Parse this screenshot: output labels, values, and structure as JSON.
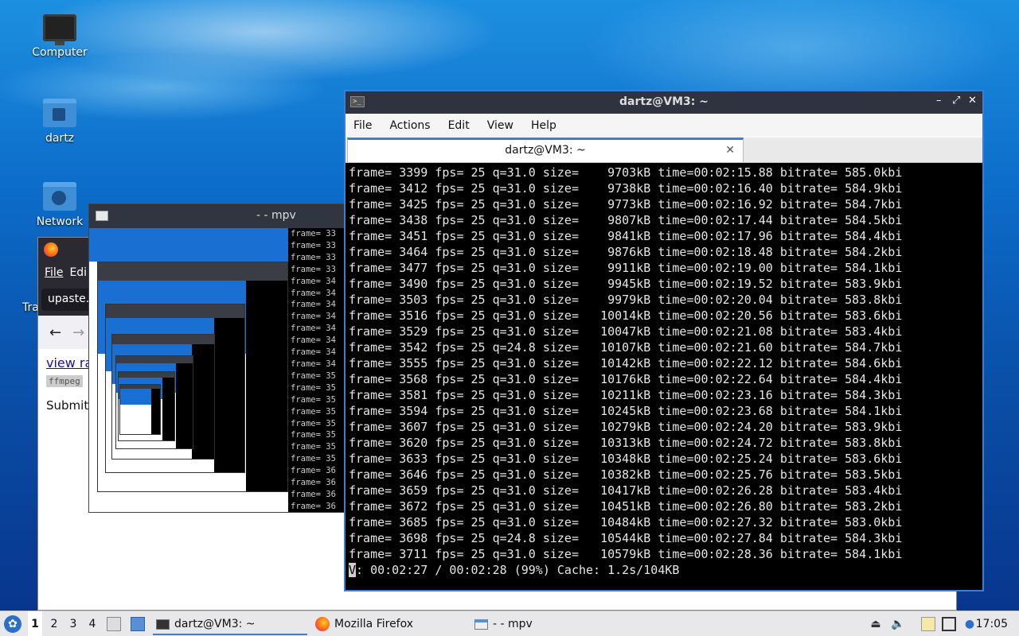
{
  "desktop": {
    "icons": [
      {
        "label": "Computer"
      },
      {
        "label": "dartz"
      },
      {
        "label": "Network"
      },
      {
        "label": "Tra"
      }
    ]
  },
  "firefox": {
    "menu": [
      "File",
      "Edi"
    ],
    "url": "upaste.c",
    "nav": {
      "back": "←",
      "forward": "→"
    },
    "view_raw": "view ra",
    "code_snippet": "ffmpeg",
    "submitted": "Submitte"
  },
  "mpv": {
    "title": "- - mpv",
    "term_lines": [
      "frame= 33",
      "frame= 33",
      "frame= 33",
      "frame= 33",
      "frame= 34",
      "frame= 34",
      "frame= 34",
      "frame= 34",
      "frame= 34",
      "frame= 34",
      "frame= 34",
      "frame= 34",
      "frame= 35",
      "frame= 35",
      "frame= 35",
      "frame= 35",
      "frame= 35",
      "frame= 35",
      "frame= 35",
      "frame= 35",
      "frame= 36",
      "frame= 36",
      "frame= 36",
      "frame= 36"
    ]
  },
  "terminal": {
    "window_title": "dartz@VM3: ~",
    "tab_title": "dartz@VM3: ~",
    "menu": [
      "File",
      "Actions",
      "Edit",
      "View",
      "Help"
    ],
    "controls": {
      "minimize": "–",
      "maximize": "⤢",
      "close": "✕"
    },
    "lines": [
      "frame= 3399 fps= 25 q=31.0 size=    9703kB time=00:02:15.88 bitrate= 585.0kbi",
      "frame= 3412 fps= 25 q=31.0 size=    9738kB time=00:02:16.40 bitrate= 584.9kbi",
      "frame= 3425 fps= 25 q=31.0 size=    9773kB time=00:02:16.92 bitrate= 584.7kbi",
      "frame= 3438 fps= 25 q=31.0 size=    9807kB time=00:02:17.44 bitrate= 584.5kbi",
      "frame= 3451 fps= 25 q=31.0 size=    9841kB time=00:02:17.96 bitrate= 584.4kbi",
      "frame= 3464 fps= 25 q=31.0 size=    9876kB time=00:02:18.48 bitrate= 584.2kbi",
      "frame= 3477 fps= 25 q=31.0 size=    9911kB time=00:02:19.00 bitrate= 584.1kbi",
      "frame= 3490 fps= 25 q=31.0 size=    9945kB time=00:02:19.52 bitrate= 583.9kbi",
      "frame= 3503 fps= 25 q=31.0 size=    9979kB time=00:02:20.04 bitrate= 583.8kbi",
      "frame= 3516 fps= 25 q=31.0 size=   10014kB time=00:02:20.56 bitrate= 583.6kbi",
      "frame= 3529 fps= 25 q=31.0 size=   10047kB time=00:02:21.08 bitrate= 583.4kbi",
      "frame= 3542 fps= 25 q=24.8 size=   10107kB time=00:02:21.60 bitrate= 584.7kbi",
      "frame= 3555 fps= 25 q=31.0 size=   10142kB time=00:02:22.12 bitrate= 584.6kbi",
      "frame= 3568 fps= 25 q=31.0 size=   10176kB time=00:02:22.64 bitrate= 584.4kbi",
      "frame= 3581 fps= 25 q=31.0 size=   10211kB time=00:02:23.16 bitrate= 584.3kbi",
      "frame= 3594 fps= 25 q=31.0 size=   10245kB time=00:02:23.68 bitrate= 584.1kbi",
      "frame= 3607 fps= 25 q=31.0 size=   10279kB time=00:02:24.20 bitrate= 583.9kbi",
      "frame= 3620 fps= 25 q=31.0 size=   10313kB time=00:02:24.72 bitrate= 583.8kbi",
      "frame= 3633 fps= 25 q=31.0 size=   10348kB time=00:02:25.24 bitrate= 583.6kbi",
      "frame= 3646 fps= 25 q=31.0 size=   10382kB time=00:02:25.76 bitrate= 583.5kbi",
      "frame= 3659 fps= 25 q=31.0 size=   10417kB time=00:02:26.28 bitrate= 583.4kbi",
      "frame= 3672 fps= 25 q=31.0 size=   10451kB time=00:02:26.80 bitrate= 583.2kbi",
      "frame= 3685 fps= 25 q=31.0 size=   10484kB time=00:02:27.32 bitrate= 583.0kbi",
      "frame= 3698 fps= 25 q=24.8 size=   10544kB time=00:02:27.84 bitrate= 584.3kbi",
      "frame= 3711 fps= 25 q=31.0 size=   10579kB time=00:02:28.36 bitrate= 584.1kbi"
    ],
    "status_cursor": "V",
    "status_line": ": 00:02:27 / 00:02:28 (99%) Cache: 1.2s/104KB"
  },
  "taskbar": {
    "workspaces": [
      "1",
      "2",
      "3",
      "4"
    ],
    "tasks": [
      {
        "label": "dartz@VM3: ~",
        "icon": "terminal-icon",
        "active": true
      },
      {
        "label": "Mozilla Firefox",
        "icon": "firefox-icon",
        "active": false
      },
      {
        "label": "- - mpv",
        "icon": "window-icon",
        "active": false
      }
    ],
    "clock": "17:05",
    "tray_icons": [
      "eject-icon",
      "volume-icon",
      "clipboard-icon",
      "network-icon",
      "notification-icon"
    ]
  }
}
